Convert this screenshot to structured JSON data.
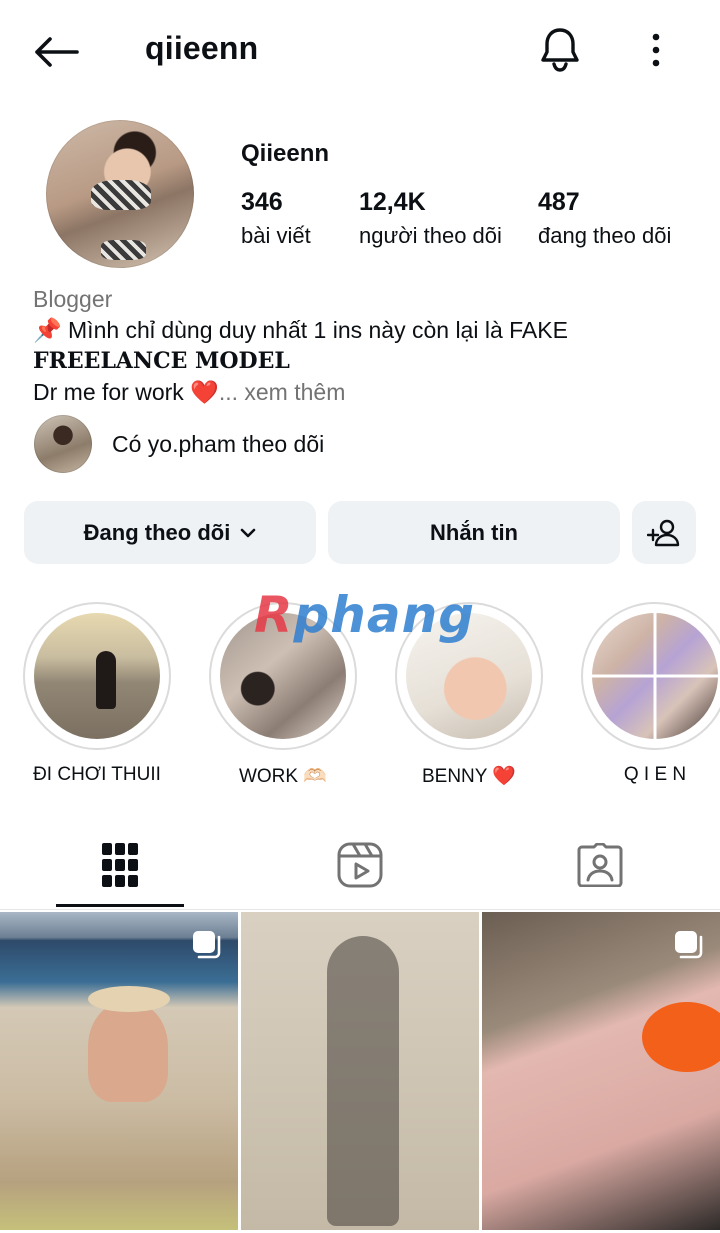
{
  "header": {
    "username": "qiieenn"
  },
  "profile": {
    "display_name": "Qiieenn",
    "stats": [
      {
        "value": "346",
        "label": "bài viết"
      },
      {
        "value": "12,4K",
        "label": "người theo dõi"
      },
      {
        "value": "487",
        "label": "đang theo dõi"
      }
    ],
    "category": "Blogger",
    "bio_line1": "📌 Mình chỉ dùng duy nhất 1 ins này còn lại là FAKE",
    "bio_line2": "FREELANCE MODEL",
    "bio_line3": "Dr me for work ❤️",
    "bio_more": "... xem thêm",
    "followed_by": "Có yo.pham theo dõi"
  },
  "actions": {
    "following_label": "Đang theo dõi",
    "message_label": "Nhắn tin"
  },
  "watermark": {
    "first": "R",
    "rest": "phang"
  },
  "highlights": [
    {
      "label": "ĐI CHƠI THUII"
    },
    {
      "label": "WORK 🫶🏻"
    },
    {
      "label": "BENNY ❤️"
    },
    {
      "label": "Q I E N"
    }
  ],
  "tabs": [
    "posts-grid",
    "reels",
    "tagged"
  ],
  "icons": {
    "back": "arrow-left-icon",
    "notifications": "bell-icon",
    "more": "more-vertical-icon",
    "suggest": "add-person-icon",
    "grid": "grid-icon",
    "reels": "reels-icon",
    "tagged": "tagged-person-icon",
    "multi_post": "carousel-icon"
  },
  "colors": {
    "button_bg": "#eff2f5",
    "text": "#0c1014",
    "muted": "#737373"
  }
}
